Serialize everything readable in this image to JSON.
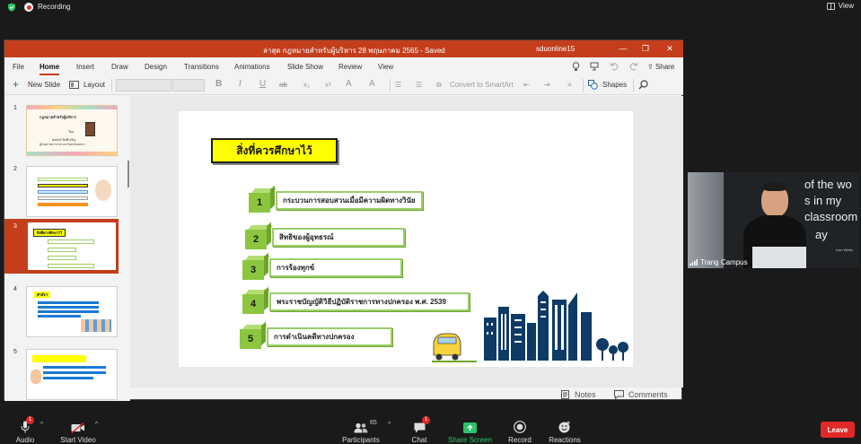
{
  "zoom": {
    "recording_label": "Recording",
    "view_label": "View",
    "colors": {
      "recording_dot": "#dd3333",
      "leave": "#e02828",
      "share_green": "#2ec268"
    }
  },
  "ppt": {
    "doc_title": "ล่าสุด กฎหมายสำหรับผู้บริหาร 28 พฤษภาคม 2565  -  Saved",
    "user": "sduonline15",
    "window_controls": {
      "minimize": "—",
      "restore": "❐",
      "close": "✕"
    },
    "menu": [
      "File",
      "Home",
      "Insert",
      "Draw",
      "Design",
      "Transitions",
      "Animations",
      "Slide Show",
      "Review",
      "View"
    ],
    "active_menu": "Home",
    "share_label": "Share",
    "ribbon": {
      "new_slide": "New Slide",
      "layout": "Layout",
      "bold": "B",
      "italic": "I",
      "underline": "U",
      "strike": "ab",
      "subscript": "x₂",
      "superscript": "x²",
      "convert_smartart": "Convert to SmartArt",
      "shapes": "Shapes"
    },
    "accent": "#c43e1c",
    "thumbnails": [
      "1",
      "2",
      "3",
      "4",
      "5"
    ],
    "selected_thumbnail": "3",
    "thumb1": {
      "title": "กฎหมายสำหรับผู้บริหาร",
      "by": "โดย",
      "name": "พรพงษ์ จิตดีเจริญ",
      "role": "ผู้ช่วยศาสตราจารย์ มหาวิทยาลัยสงขลา"
    },
    "thumb3_title": "สิ่งที่ควรศึกษาไว้",
    "thumb4_title": "คำสั่งฯ",
    "bottom": {
      "notes": "Notes",
      "comments": "Comments"
    }
  },
  "slide": {
    "title": "สิ่งที่ควรศึกษาไว้",
    "items": [
      {
        "num": "1",
        "text": "กระบวนการสอบสวนเมื่อมีความผิดทางวินัย"
      },
      {
        "num": "2",
        "text": "สิทธิของผู้อุทธรณ์"
      },
      {
        "num": "3",
        "text": "การร้องทุกข์"
      },
      {
        "num": "4",
        "text": "พระราชบัญญัติวิธีปฏิบัติราชการทางปกครอง พ.ศ. 2539"
      },
      {
        "num": "5",
        "text": "การดำเนินคดีทางปกครอง"
      }
    ],
    "colors": {
      "title_bg": "#ffff00",
      "cube": "#8cc63f",
      "box_border": "#9bcd6b",
      "city": "#0d3b66"
    }
  },
  "video": {
    "participant": "Trang Campus",
    "board_text": [
      "of the wo",
      "s in my",
      "classroom",
      "ay"
    ],
    "board_sign": "Ivan Welto"
  },
  "toolbar": {
    "audio": "Audio",
    "start_video": "Start Video",
    "participants": "Participants",
    "participants_count": "65",
    "chat": "Chat",
    "chat_badge": "1",
    "audio_badge": "1",
    "share_screen": "Share Screen",
    "record": "Record",
    "reactions": "Reactions",
    "leave": "Leave"
  }
}
